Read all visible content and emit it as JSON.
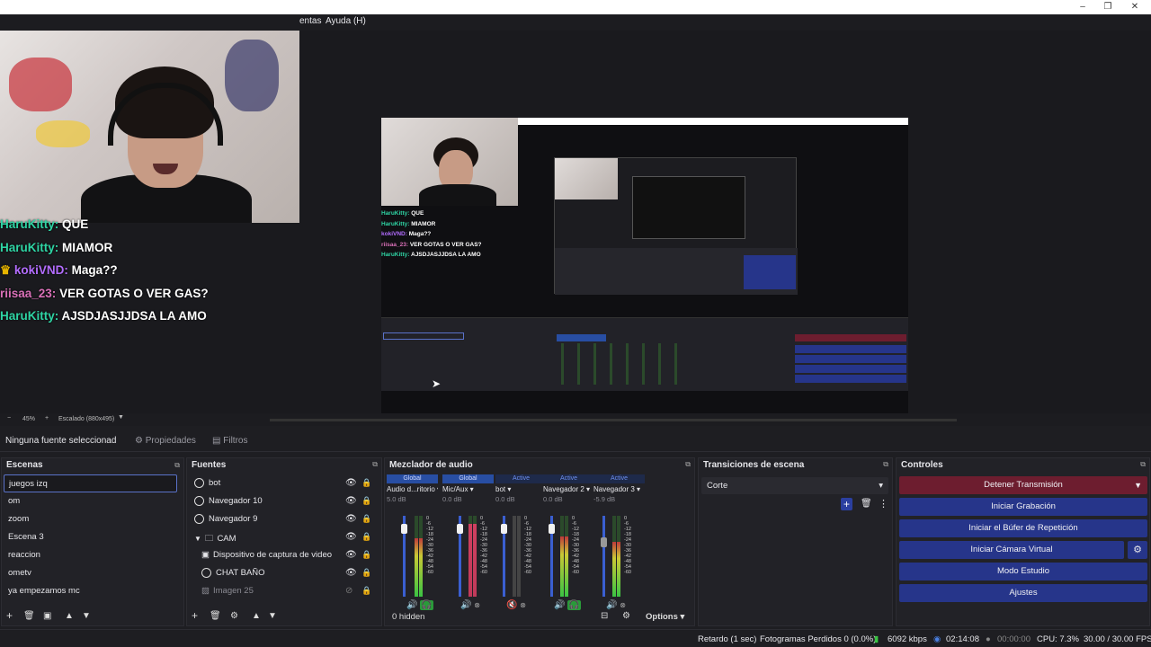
{
  "window": {
    "minimize": "–",
    "restore": "❐",
    "close": "✕"
  },
  "menu": {
    "items": [
      "entas",
      "Ayuda (H)"
    ]
  },
  "chat": [
    {
      "user": "HaruKitty:",
      "message": "QUE",
      "color": "green"
    },
    {
      "user": "HaruKitty:",
      "message": "MIAMOR",
      "color": "green"
    },
    {
      "user": "kokiVND:",
      "message": "Maga??",
      "color": "purple"
    },
    {
      "user": "riisaa_23:",
      "message": "VER GOTAS O VER GAS?",
      "color": "pink"
    },
    {
      "user": "HaruKitty:",
      "message": "AJSDJASJJDSA LA AMO",
      "color": "green"
    }
  ],
  "nested_chat": [
    {
      "user": "HaruKitty:",
      "message": "QUE"
    },
    {
      "user": "HaruKitty:",
      "message": "MIAMOR"
    },
    {
      "user": "kokiVND:",
      "message": "Maga??"
    },
    {
      "user": "riisaa_23:",
      "message": "VER GOTAS O VER GAS?"
    },
    {
      "user": "HaruKitty:",
      "message": "AJSDJASJJDSA LA AMO"
    }
  ],
  "zoom": {
    "level": "45%",
    "scale_label": "Escalado (880x495)"
  },
  "source_toolbar": {
    "no_source": "Ninguna fuente seleccionad",
    "properties": "Propiedades",
    "filters": "Filtros"
  },
  "scenes": {
    "title": "Escenas",
    "items": [
      "juegos izq",
      "om",
      "zoom",
      "Escena 3",
      "reaccion",
      "ometv",
      "ya empezamos mc"
    ]
  },
  "sources": {
    "title": "Fuentes",
    "items": [
      "bot",
      "Navegador 10",
      "Navegador 9",
      "CAM",
      "Dispositivo de captura de video",
      "CHAT BAÑO",
      "Imagen 25"
    ]
  },
  "mixer": {
    "title": "Mezclador de audio",
    "channels": [
      {
        "header": "Global",
        "name": "Audio d...ritorio",
        "db": "5.0 dB",
        "level": 0.72
      },
      {
        "header": "Global",
        "name": "Mic/Aux",
        "db": "0.0 dB",
        "level": 0.9
      },
      {
        "header": "Active",
        "name": "bot",
        "db": "0.0 dB",
        "level": 0.0
      },
      {
        "header": "Active",
        "name": "Navegador 2",
        "db": "0.0 dB",
        "level": 0.75
      },
      {
        "header": "Active",
        "name": "Navegador 3",
        "db": "-5.9 dB",
        "level": 0.68
      }
    ],
    "hidden": "0 hidden",
    "options": "Options"
  },
  "transitions": {
    "title": "Transiciones de escena",
    "selected": "Corte"
  },
  "controls": {
    "title": "Controles",
    "buttons": [
      "Detener Transmisión",
      "Iniciar Grabación",
      "Iniciar el Búfer de Repetición",
      "Iniciar Cámara Virtual",
      "Modo Estudio",
      "Ajustes"
    ]
  },
  "status": {
    "delay": "Retardo (1 sec)",
    "dropped": "Fotogramas Perdidos 0 (0.0%)",
    "bitrate": "6092 kbps",
    "stream_time": "02:14:08",
    "rec_time": "00:00:00",
    "cpu": "CPU: 7.3%",
    "fps": "30.00 / 30.00 FPS"
  },
  "colors": {
    "accent": "#284ea3",
    "stop": "#6d1d2f",
    "chat_green": "#2fd4a4",
    "chat_purple": "#b36dff",
    "chat_pink": "#d970b7"
  }
}
